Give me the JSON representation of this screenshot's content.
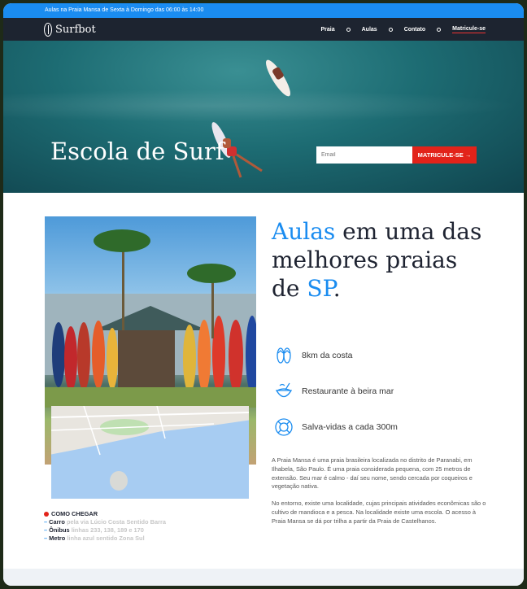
{
  "topbar": {
    "text": "Aulas na Praia Mansa de Sexta à Domingo das 06:00 às 14:00"
  },
  "brand": {
    "name": "Surfbot"
  },
  "nav": {
    "items": [
      "Praia",
      "Aulas",
      "Contato",
      "Matricule-se"
    ]
  },
  "hero": {
    "title": "Escola de Surf",
    "email_placeholder": "Email",
    "cta": "MATRICULE-SE →"
  },
  "headline": {
    "part1": "Aulas",
    "part2": " em uma das melhores praias de ",
    "part3": "SP",
    "part4": "."
  },
  "features": [
    {
      "icon": "flip-flops-icon",
      "label": "8km da costa"
    },
    {
      "icon": "coconut-drink-icon",
      "label": "Restaurante à beira mar"
    },
    {
      "icon": "lifebuoy-icon",
      "label": "Salva-vidas a cada 300m"
    }
  ],
  "description": [
    "A Praia Mansa é uma praia brasileira localizada no distrito de Paranabi, em Ilhabela, São Paulo. É uma praia considerada pequena, com 25 metros de extensão. Seu mar é calmo - daí seu nome, sendo cercada por coqueiros e vegetação nativa.",
    "No entorno, existe uma localidade, cujas principais atividades econômicas são o cultivo de mandioca e a pesca. Na localidade existe uma escola. O acesso à Praia Mansa se dá por trilha a partir da Praia de Castelhanos."
  ],
  "directions": {
    "title": "COMO CHEGAR",
    "items": [
      {
        "mode": "Carro",
        "detail": "pela via Lúcio Costa Sentido Barra"
      },
      {
        "mode": "Ônibus",
        "detail": "linhas 233, 138, 189 e 170"
      },
      {
        "mode": "Metro",
        "detail": "linha azul sentido Zona Sul"
      }
    ]
  },
  "colors": {
    "accent": "#1a8cf0",
    "cta": "#e2231a",
    "nav": "#1d2430"
  }
}
